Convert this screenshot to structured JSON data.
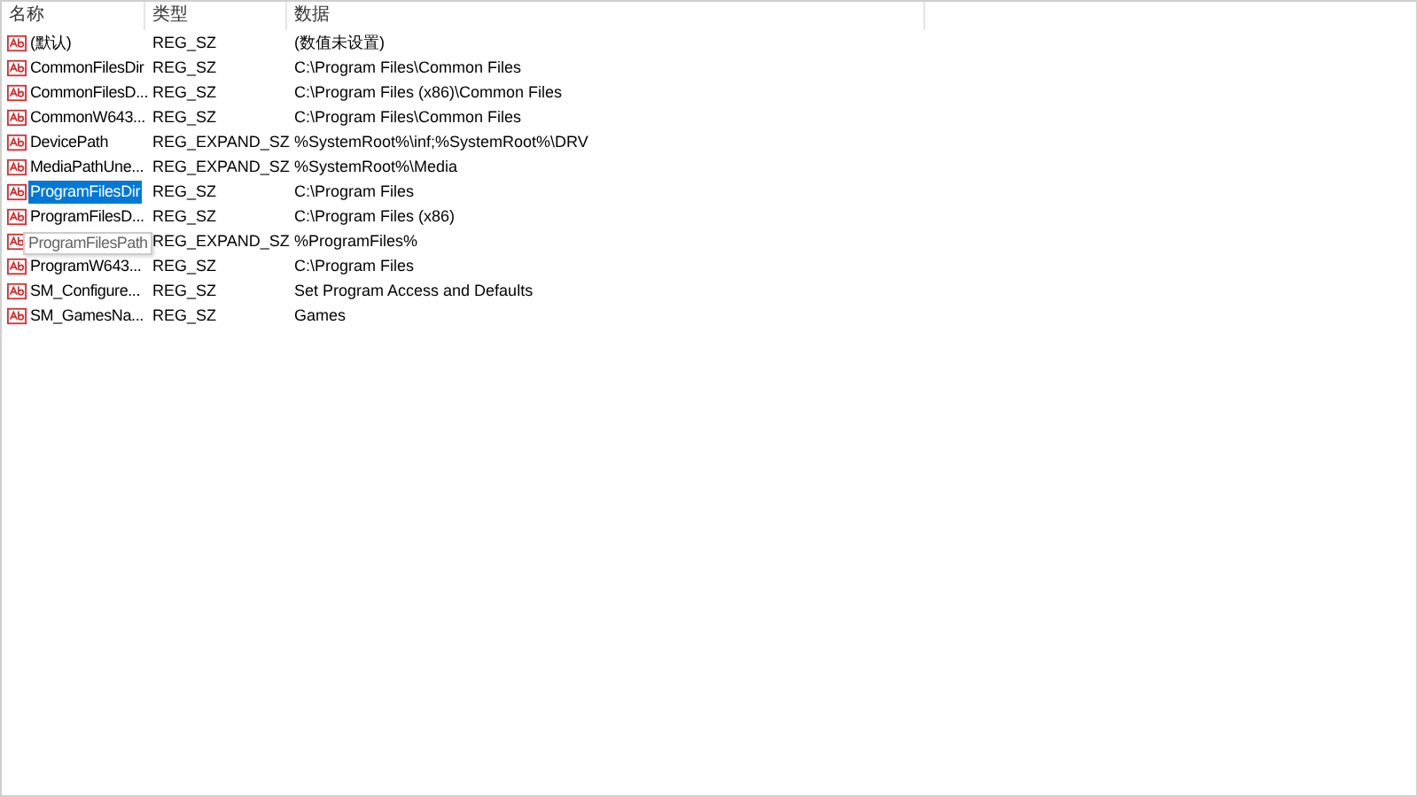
{
  "columns": [
    "名称",
    "类型",
    "数据"
  ],
  "rows": [
    {
      "name": "(默认)",
      "type": "REG_SZ",
      "data": "(数值未设置)",
      "selected": false
    },
    {
      "name": "CommonFilesDir",
      "type": "REG_SZ",
      "data": "C:\\Program Files\\Common Files",
      "selected": false
    },
    {
      "name": "CommonFilesD...",
      "type": "REG_SZ",
      "data": "C:\\Program Files (x86)\\Common Files",
      "selected": false
    },
    {
      "name": "CommonW643...",
      "type": "REG_SZ",
      "data": "C:\\Program Files\\Common Files",
      "selected": false
    },
    {
      "name": "DevicePath",
      "type": "REG_EXPAND_SZ",
      "data": "%SystemRoot%\\inf;%SystemRoot%\\DRV",
      "selected": false
    },
    {
      "name": "MediaPathUne...",
      "type": "REG_EXPAND_SZ",
      "data": "%SystemRoot%\\Media",
      "selected": false
    },
    {
      "name": "ProgramFilesDir",
      "type": "REG_SZ",
      "data": "C:\\Program Files",
      "selected": true
    },
    {
      "name": "ProgramFilesD...",
      "type": "REG_SZ",
      "data": "C:\\Program Files (x86)",
      "selected": false
    },
    {
      "tooltip": "ProgramFilesPath",
      "type": "REG_EXPAND_SZ",
      "data": "%ProgramFiles%",
      "selected": false
    },
    {
      "name": "ProgramW643...",
      "type": "REG_SZ",
      "data": "C:\\Program Files",
      "selected": false
    },
    {
      "name": "SM_Configure...",
      "type": "REG_SZ",
      "data": "Set Program Access and Defaults",
      "selected": false
    },
    {
      "name": "SM_GamesNa...",
      "type": "REG_SZ",
      "data": "Games",
      "selected": false
    }
  ]
}
